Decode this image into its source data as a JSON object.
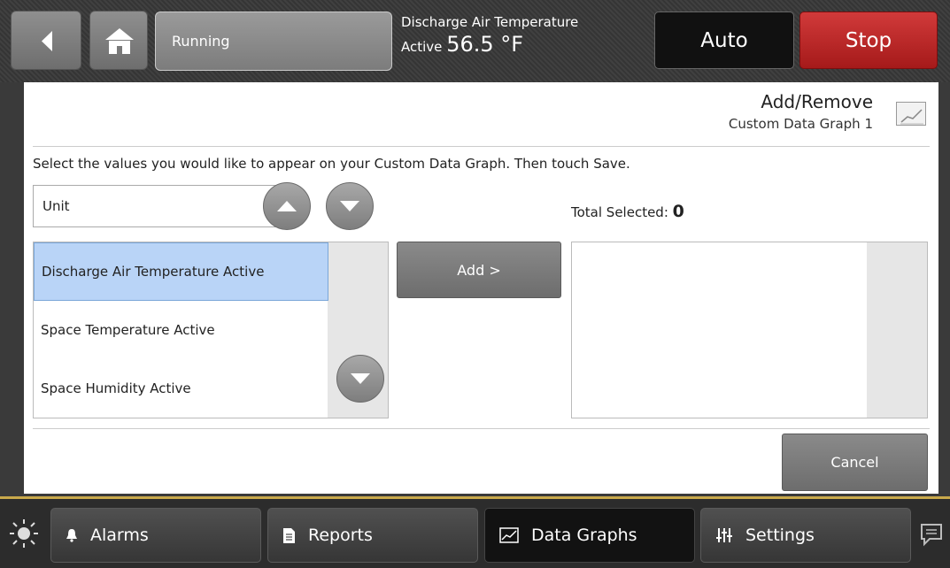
{
  "header": {
    "status": "Running",
    "point_label": "Discharge Air Temperature",
    "point_state": "Active",
    "point_value": "56.5 °F",
    "auto_label": "Auto",
    "stop_label": "Stop",
    "icons": [
      "back-arrow-icon",
      "home-icon"
    ]
  },
  "panel": {
    "title": "Add/Remove",
    "subtitle": "Custom Data Graph 1",
    "instructions": "Select the values you would like to appear on your Custom Data Graph. Then touch Save.",
    "category": "Unit",
    "total_label": "Total Selected: ",
    "total_count": "0",
    "available_items": [
      "Discharge Air Temperature Active",
      "Space Temperature Active",
      "Space Humidity Active"
    ],
    "selected_item_index": 0,
    "add_label": "Add >",
    "cancel_label": "Cancel"
  },
  "nav": {
    "tabs": [
      {
        "label": "Alarms",
        "icon": "bell-icon"
      },
      {
        "label": "Reports",
        "icon": "document-icon"
      },
      {
        "label": "Data Graphs",
        "icon": "graph-icon",
        "active": true
      },
      {
        "label": "Settings",
        "icon": "sliders-icon"
      }
    ]
  },
  "colors": {
    "stop": "#b52020",
    "selection": "#b9d4f7",
    "accent_line": "#c9a94b"
  }
}
